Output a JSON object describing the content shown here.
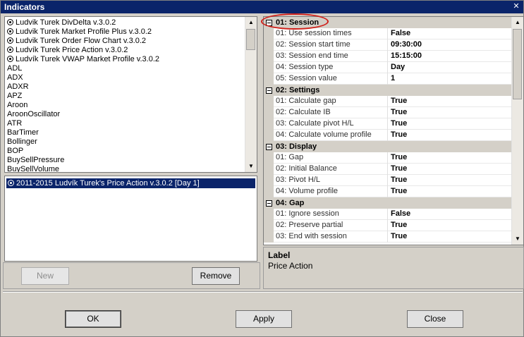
{
  "window": {
    "title": "Indicators",
    "close_glyph": "✕"
  },
  "indicator_list": {
    "items": [
      {
        "label": "Ludvik Turek DivDelta v.3.0.2",
        "icon": "radio-icon"
      },
      {
        "label": "Ludvik Turek Market Profile Plus v.3.0.2",
        "icon": "radio-icon"
      },
      {
        "label": "Ludvik Turek Order Flow Chart v.3.0.2",
        "icon": "radio-icon"
      },
      {
        "label": "Ludvík Turek Price Action v.3.0.2",
        "icon": "radio-icon"
      },
      {
        "label": "Ludvík Turek VWAP Market Profile v.3.0.2",
        "icon": "radio-icon"
      },
      {
        "label": "ADL"
      },
      {
        "label": "ADX"
      },
      {
        "label": "ADXR"
      },
      {
        "label": "APZ"
      },
      {
        "label": "Aroon"
      },
      {
        "label": "AroonOscillator"
      },
      {
        "label": "ATR"
      },
      {
        "label": "BarTimer"
      },
      {
        "label": "Bollinger"
      },
      {
        "label": "BOP"
      },
      {
        "label": "BuySellPressure"
      },
      {
        "label": "BuySellVolume"
      }
    ],
    "scroll_up_glyph": "▲",
    "scroll_down_glyph": "▼"
  },
  "applied_list": {
    "items": [
      {
        "label": "2011-2015 Ludvík Turek's Price Action v.3.0.2 [Day 1]",
        "icon": "radio-icon",
        "selected": true
      }
    ]
  },
  "left_buttons": {
    "new_label": "New",
    "remove_label": "Remove"
  },
  "properties": {
    "categories": [
      {
        "label": "01: Session",
        "props": [
          {
            "name": "01: Use session times",
            "value": "False"
          },
          {
            "name": "02: Session start time",
            "value": "09:30:00"
          },
          {
            "name": "03: Session end time",
            "value": "15:15:00"
          },
          {
            "name": "04: Session type",
            "value": "Day"
          },
          {
            "name": "05: Session value",
            "value": "1"
          }
        ]
      },
      {
        "label": "02: Settings",
        "props": [
          {
            "name": "01: Calculate gap",
            "value": "True"
          },
          {
            "name": "02: Calculate IB",
            "value": "True"
          },
          {
            "name": "03: Calculate pivot H/L",
            "value": "True"
          },
          {
            "name": "04: Calculate volume profile",
            "value": "True"
          }
        ]
      },
      {
        "label": "03: Display",
        "props": [
          {
            "name": "01: Gap",
            "value": "True"
          },
          {
            "name": "02: Initial Balance",
            "value": "True"
          },
          {
            "name": "03: Pivot H/L",
            "value": "True"
          },
          {
            "name": "04: Volume profile",
            "value": "True"
          }
        ]
      },
      {
        "label": "04: Gap",
        "props": [
          {
            "name": "01: Ignore session",
            "value": "False"
          },
          {
            "name": "02: Preserve partial",
            "value": "True"
          },
          {
            "name": "03: End with session",
            "value": "True"
          }
        ]
      }
    ],
    "highlight_color": "#d0201a"
  },
  "label_panel": {
    "title": "Label",
    "value": "Price Action"
  },
  "footer_buttons": {
    "ok_label": "OK",
    "apply_label": "Apply",
    "close_label": "Close"
  },
  "colors": {
    "titlebar": "#0a246a",
    "selection": "#0a246a",
    "dialog_bg": "#d4d0c8"
  }
}
